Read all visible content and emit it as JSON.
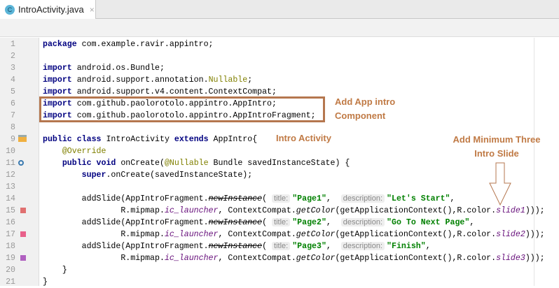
{
  "tab": {
    "title": "IntroActivity.java",
    "icon": "class-c-icon",
    "close": "×",
    "icon_letter": "C"
  },
  "gutter_marks": {
    "15": "#e07070",
    "17": "#e8608a",
    "19": "#b060c0"
  },
  "lines": [
    [
      [
        "package",
        "kw"
      ],
      [
        " com.example.ravir.appintro;",
        ""
      ]
    ],
    [],
    [
      [
        "import",
        "kw"
      ],
      [
        " android.os.Bundle;",
        ""
      ]
    ],
    [
      [
        "import",
        "kw"
      ],
      [
        " android.support.annotation.",
        ""
      ],
      [
        "Nullable",
        "ann"
      ],
      [
        ";",
        ""
      ]
    ],
    [
      [
        "import",
        "kw"
      ],
      [
        " android.support.v4.content.ContextCompat;",
        ""
      ]
    ],
    [
      [
        "import",
        "kw"
      ],
      [
        " com.github.paolorotolo.appintro.AppIntro;",
        ""
      ]
    ],
    [
      [
        "import",
        "kw"
      ],
      [
        " com.github.paolorotolo.appintro.AppIntroFragment;",
        ""
      ]
    ],
    [],
    [
      [
        "public class",
        "kw"
      ],
      [
        " IntroActivity ",
        ""
      ],
      [
        "extends",
        "kw"
      ],
      [
        " AppIntro{",
        ""
      ]
    ],
    [
      [
        "    ",
        ""
      ],
      [
        "@Override",
        "ann"
      ]
    ],
    [
      [
        "    ",
        ""
      ],
      [
        "public void",
        "kw"
      ],
      [
        " onCreate(",
        ""
      ],
      [
        "@Nullable",
        "ann"
      ],
      [
        " Bundle savedInstanceState) {",
        ""
      ]
    ],
    [
      [
        "        ",
        ""
      ],
      [
        "super",
        "kw"
      ],
      [
        ".onCreate(savedInstanceState);",
        ""
      ]
    ],
    [],
    [
      [
        "        addSlide(AppIntroFragment.",
        ""
      ],
      [
        "newInstance",
        "m dep"
      ],
      [
        "( ",
        ""
      ],
      [
        "title:",
        "hint"
      ],
      [
        "\"Page1\"",
        "str"
      ],
      [
        ",  ",
        ""
      ],
      [
        "description:",
        "hint"
      ],
      [
        "\"Let's Start\"",
        "str"
      ],
      [
        ",",
        ""
      ]
    ],
    [
      [
        "                R.mipmap.",
        ""
      ],
      [
        "ic_launcher",
        "it"
      ],
      [
        ", ContextCompat.",
        ""
      ],
      [
        "getColor",
        "m"
      ],
      [
        "(getApplicationContext(),R.color.",
        ""
      ],
      [
        "slide1",
        "it"
      ],
      [
        ")));",
        ""
      ]
    ],
    [
      [
        "        addSlide(AppIntroFragment.",
        ""
      ],
      [
        "newInstance",
        "m dep"
      ],
      [
        "( ",
        ""
      ],
      [
        "title:",
        "hint"
      ],
      [
        "\"Page2\"",
        "str"
      ],
      [
        ",  ",
        ""
      ],
      [
        "description:",
        "hint"
      ],
      [
        "\"Go To Next Page\"",
        "str"
      ],
      [
        ",",
        ""
      ]
    ],
    [
      [
        "                R.mipmap.",
        ""
      ],
      [
        "ic_launcher",
        "it"
      ],
      [
        ", ContextCompat.",
        ""
      ],
      [
        "getColor",
        "m"
      ],
      [
        "(getApplicationContext(),R.color.",
        ""
      ],
      [
        "slide2",
        "it"
      ],
      [
        ")));",
        ""
      ]
    ],
    [
      [
        "        addSlide(AppIntroFragment.",
        ""
      ],
      [
        "newInstance",
        "m dep"
      ],
      [
        "( ",
        ""
      ],
      [
        "title:",
        "hint"
      ],
      [
        "\"Page3\"",
        "str"
      ],
      [
        ",  ",
        ""
      ],
      [
        "description:",
        "hint"
      ],
      [
        "\"Finish\"",
        "str"
      ],
      [
        ",",
        ""
      ]
    ],
    [
      [
        "                R.mipmap.",
        ""
      ],
      [
        "ic_launcher",
        "it"
      ],
      [
        ", ContextCompat.",
        ""
      ],
      [
        "getColor",
        "m"
      ],
      [
        "(getApplicationContext(),R.color.",
        ""
      ],
      [
        "slide3",
        "it"
      ],
      [
        ")));",
        ""
      ]
    ],
    [
      [
        "    }",
        ""
      ]
    ],
    [
      [
        "}",
        ""
      ]
    ]
  ],
  "annotations": {
    "component": [
      "Add App intro",
      "Component"
    ],
    "activity": "Intro Activity",
    "slides": [
      "Add Minimum Three",
      "Intro Slide"
    ]
  }
}
